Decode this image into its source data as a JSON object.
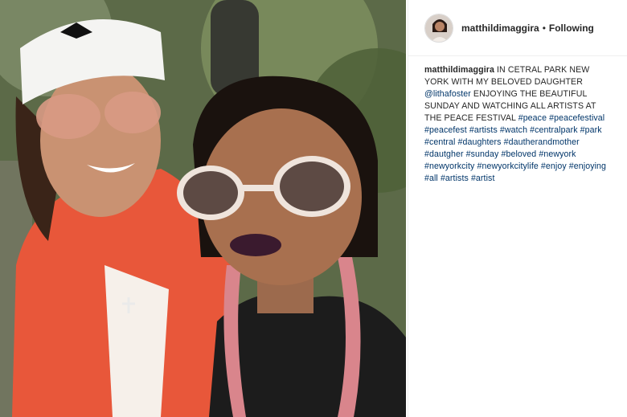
{
  "photo": {
    "icon": "photo-of-two-women"
  },
  "post": {
    "username": "matthildimaggira",
    "separator": "•",
    "follow_status": "Following",
    "caption_text_1": " IN CETRAL PARK NEW YORK WITH MY BELOVED DAUGHTER ",
    "mention": "@lithafoster",
    "caption_text_2": " ENJOYING THE BEAUTIFUL SUNDAY AND WATCHING ALL ARTISTS AT THE PEACE FESTIVAL",
    "hashtags": [
      "#peace",
      "#peacefestival",
      "#peacefest",
      "#artists",
      "#watch",
      "#centralpark",
      "#park",
      "#central",
      "#daughters",
      "#dautherandmother",
      "#dautgher",
      "#sunday",
      "#beloved",
      "#newyork",
      "#newyorkcity",
      "#newyorkcitylife",
      "#enjoy",
      "#enjoying",
      "#all",
      "#artists",
      "#artist"
    ]
  },
  "colors": {
    "link": "#003569",
    "text": "#262626",
    "border": "#efefef"
  }
}
